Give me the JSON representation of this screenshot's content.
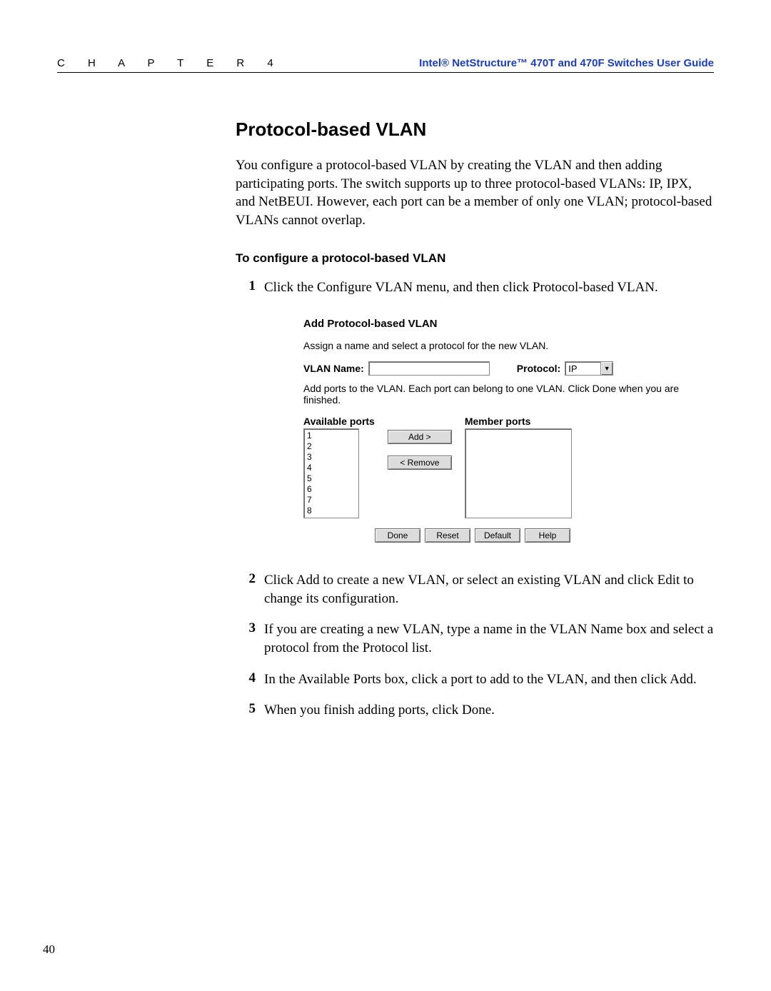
{
  "header": {
    "chapter_label": "C H A P T E R   4",
    "doc_title": "Intel® NetStructure™ 470T and 470F Switches User Guide"
  },
  "section": {
    "heading": "Protocol-based VLAN",
    "intro": "You configure a protocol-based VLAN by creating the VLAN and then adding participating ports. The switch supports up to three protocol-based VLANs: IP, IPX, and NetBEUI. However, each port can be a member of only one VLAN; protocol-based VLANs cannot overlap.",
    "sub_heading": "To configure a protocol-based VLAN",
    "steps": [
      {
        "n": "1",
        "text": "Click the Configure VLAN menu, and then click Protocol-based VLAN."
      },
      {
        "n": "2",
        "text": "Click Add to create a new VLAN, or select an existing VLAN and click Edit to change its configuration."
      },
      {
        "n": "3",
        "text": "If you are creating a new VLAN, type a name in the VLAN Name box and select a protocol from the Protocol list."
      },
      {
        "n": "4",
        "text": "In the Available Ports box, click a port to add to the VLAN, and then click Add."
      },
      {
        "n": "5",
        "text": "When you finish adding ports, click Done."
      }
    ]
  },
  "dialog": {
    "title": "Add Protocol-based VLAN",
    "instruction1": "Assign a name and select a protocol for the new VLAN.",
    "vlan_name_label": "VLAN Name:",
    "vlan_name_value": "",
    "protocol_label": "Protocol:",
    "protocol_value": "IP",
    "instruction2": "Add ports to the VLAN. Each port can belong to one VLAN. Click Done when you are finished.",
    "available_label": "Available ports",
    "member_label": "Member ports",
    "available_ports": [
      "1",
      "2",
      "3",
      "4",
      "5",
      "6",
      "7",
      "8"
    ],
    "member_ports": [],
    "add_btn": "Add   >",
    "remove_btn": "< Remove",
    "done_btn": "Done",
    "reset_btn": "Reset",
    "default_btn": "Default",
    "help_btn": "Help"
  },
  "page_number": "40"
}
